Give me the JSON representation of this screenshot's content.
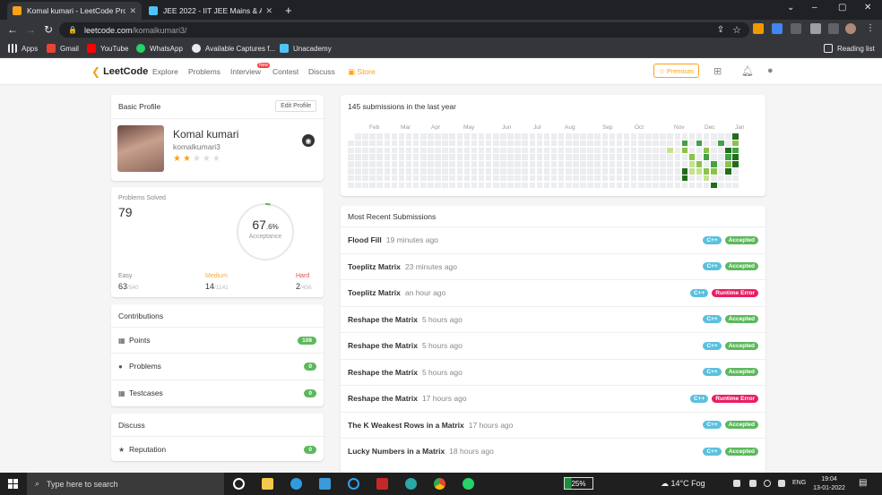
{
  "browser": {
    "tabs": [
      {
        "title": "Komal kumari - LeetCode Profile",
        "active": true
      },
      {
        "title": "JEE 2022 - IIT JEE Mains & Advan",
        "active": false
      }
    ],
    "new_tab": "+",
    "window_controls": [
      "⌄",
      "–",
      "▢",
      "✕"
    ],
    "url_host": "leetcode.com",
    "url_path": "/komalkumari3/",
    "bookmarks": [
      "Apps",
      "Gmail",
      "YouTube",
      "WhatsApp",
      "Available Captures f...",
      "Unacademy"
    ],
    "reading_list": "Reading list"
  },
  "site": {
    "logo": "LeetCode",
    "nav": [
      "Explore",
      "Problems",
      "Interview",
      "Contest",
      "Discuss",
      "Store"
    ],
    "new_badge": "New",
    "premium": "☆ Premium"
  },
  "profile": {
    "section_title": "Basic Profile",
    "edit_label": "Edit Profile",
    "name": "Komal kumari",
    "username": "komalkumari3",
    "stars": 2,
    "star_total": 5
  },
  "problems_solved": {
    "label": "Problems Solved",
    "total": "79",
    "acceptance_int": "67",
    "acceptance_dec": ".6%",
    "acceptance_label": "Acceptance",
    "acceptance_value": 67.6,
    "easy_label": "Easy",
    "easy_solved": "63",
    "easy_total": "/540",
    "medium_label": "Medium",
    "medium_solved": "14",
    "medium_total": "/1141",
    "hard_label": "Hard",
    "hard_solved": "2",
    "hard_total": "/456"
  },
  "contributions": {
    "title": "Contributions",
    "items": [
      {
        "label": "Points",
        "value": "108"
      },
      {
        "label": "Problems",
        "value": "0"
      },
      {
        "label": "Testcases",
        "value": "0"
      }
    ]
  },
  "discuss": {
    "title": "Discuss",
    "items": [
      {
        "label": "Reputation",
        "value": "0"
      }
    ]
  },
  "heatmap": {
    "title": "145 submissions in the last year",
    "months": [
      "Feb",
      "Mar",
      "Apr",
      "May",
      "Jun",
      "Jul",
      "Aug",
      "Sep",
      "Oct",
      "Nov",
      "Dec",
      "Jan"
    ],
    "weeks": 53,
    "active_cells": [
      {
        "week": 44,
        "day": 2,
        "level": 1
      },
      {
        "week": 46,
        "day": 1,
        "level": 3
      },
      {
        "week": 46,
        "day": 2,
        "level": 2
      },
      {
        "week": 46,
        "day": 5,
        "level": 4
      },
      {
        "week": 46,
        "day": 6,
        "level": 4
      },
      {
        "week": 47,
        "day": 3,
        "level": 2
      },
      {
        "week": 47,
        "day": 4,
        "level": 1
      },
      {
        "week": 47,
        "day": 5,
        "level": 1
      },
      {
        "week": 48,
        "day": 1,
        "level": 3
      },
      {
        "week": 48,
        "day": 4,
        "level": 2
      },
      {
        "week": 48,
        "day": 5,
        "level": 1
      },
      {
        "week": 49,
        "day": 2,
        "level": 2
      },
      {
        "week": 49,
        "day": 3,
        "level": 3
      },
      {
        "week": 49,
        "day": 5,
        "level": 2
      },
      {
        "week": 49,
        "day": 6,
        "level": 1
      },
      {
        "week": 50,
        "day": 4,
        "level": 3
      },
      {
        "week": 50,
        "day": 5,
        "level": 2
      },
      {
        "week": 50,
        "day": 7,
        "level": 4
      },
      {
        "week": 51,
        "day": 1,
        "level": 3
      },
      {
        "week": 52,
        "day": 2,
        "level": 4
      },
      {
        "week": 52,
        "day": 3,
        "level": 3
      },
      {
        "week": 52,
        "day": 4,
        "level": 2
      },
      {
        "week": 52,
        "day": 5,
        "level": 4
      },
      {
        "week": 53,
        "day": 0,
        "level": 4
      },
      {
        "week": 53,
        "day": 1,
        "level": 2
      },
      {
        "week": 53,
        "day": 2,
        "level": 3
      },
      {
        "week": 53,
        "day": 3,
        "level": 4
      },
      {
        "week": 53,
        "day": 4,
        "level": 4
      }
    ],
    "colors": {
      "empty": "#ebedf0",
      "l1": "#c4e28e",
      "l2": "#8bc34a",
      "l3": "#43a047",
      "l4": "#216e1a"
    }
  },
  "submissions": {
    "title": "Most Recent Submissions",
    "items": [
      {
        "title": "Flood Fill",
        "time": "19 minutes ago",
        "lang": "C++",
        "status": "Accepted",
        "ok": true
      },
      {
        "title": "Toeplitz Matrix",
        "time": "23 minutes ago",
        "lang": "C++",
        "status": "Accepted",
        "ok": true
      },
      {
        "title": "Toeplitz Matrix",
        "time": "an hour ago",
        "lang": "C++",
        "status": "Runtime Error",
        "ok": false
      },
      {
        "title": "Reshape the Matrix",
        "time": "5 hours ago",
        "lang": "C++",
        "status": "Accepted",
        "ok": true
      },
      {
        "title": "Reshape the Matrix",
        "time": "5 hours ago",
        "lang": "C++",
        "status": "Accepted",
        "ok": true
      },
      {
        "title": "Reshape the Matrix",
        "time": "5 hours ago",
        "lang": "C++",
        "status": "Accepted",
        "ok": true
      },
      {
        "title": "Reshape the Matrix",
        "time": "17 hours ago",
        "lang": "C++",
        "status": "Runtime Error",
        "ok": false
      },
      {
        "title": "The K Weakest Rows in a Matrix",
        "time": "17 hours ago",
        "lang": "C++",
        "status": "Accepted",
        "ok": true
      },
      {
        "title": "Lucky Numbers in a Matrix",
        "time": "18 hours ago",
        "lang": "C++",
        "status": "Accepted",
        "ok": true
      }
    ],
    "colors": {
      "accepted": "#5cb85c",
      "error": "#e91e63"
    }
  },
  "taskbar": {
    "search_placeholder": "Type here to search",
    "battery": "25%",
    "weather": "14°C  Fog",
    "lang": "ENG",
    "time": "19:04",
    "date": "13-01-2022"
  }
}
